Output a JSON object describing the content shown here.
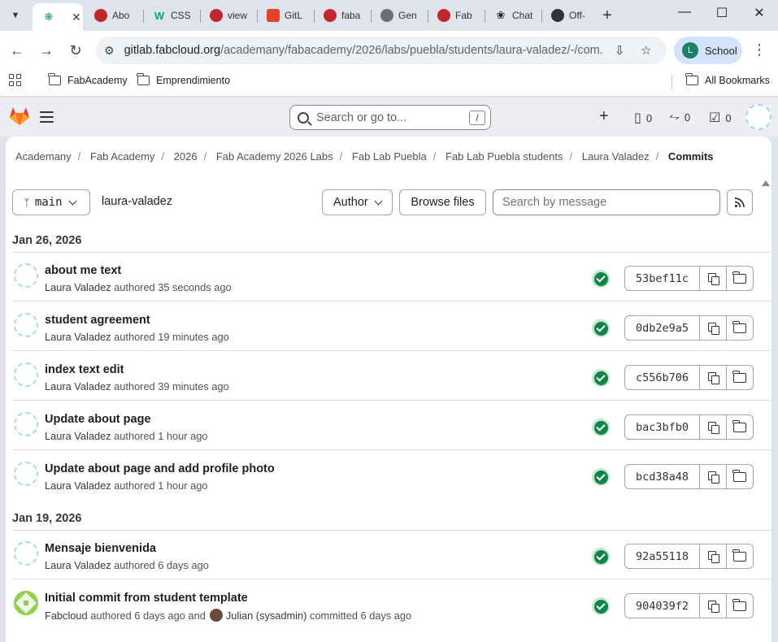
{
  "browser": {
    "tabs": [
      {
        "label": "",
        "favicon": "gitlab-swirl-icon",
        "active": true
      },
      {
        "label": "Abo",
        "favicon": "fab-lab-icon"
      },
      {
        "label": "CSS",
        "favicon": "w3schools-icon"
      },
      {
        "label": "view",
        "favicon": "fab-lab-icon"
      },
      {
        "label": "GitL",
        "favicon": "gitlab-icon"
      },
      {
        "label": "faba",
        "favicon": "fab-lab-icon"
      },
      {
        "label": "Gen",
        "favicon": "globe-icon"
      },
      {
        "label": "Fab",
        "favicon": "fab-lab-icon"
      },
      {
        "label": "Chat",
        "favicon": "chatgpt-icon"
      },
      {
        "label": "Off-",
        "favicon": "offline-icon"
      }
    ],
    "url_host": "gitlab.fabcloud.org",
    "url_path": "/academany/fabacademy/2026/labs/puebla/students/laura-valadez/-/com...",
    "profile_initial": "L",
    "profile_name": "School",
    "bookmarks": [
      "FabAcademy",
      "Emprendimiento"
    ],
    "all_bookmarks": "All Bookmarks"
  },
  "gitlab": {
    "search_placeholder": "Search or go to...",
    "search_shortcut": "/",
    "counts": {
      "issues": "0",
      "merge_requests": "0",
      "todos": "0"
    },
    "breadcrumbs": [
      "Academany",
      "Fab Academy",
      "2026",
      "Fab Academy 2026 Labs",
      "Fab Lab Puebla",
      "Fab Lab Puebla students",
      "Laura Valadez"
    ],
    "breadcrumb_current": "Commits",
    "branch": "main",
    "path": "laura-valadez",
    "author_label": "Author",
    "browse_label": "Browse files",
    "message_placeholder": "Search by message",
    "days": [
      {
        "date": "Jan 26, 2026",
        "commits": [
          {
            "title": "about me text",
            "author": "Laura Valadez",
            "action": "authored 35 seconds ago",
            "sha": "53bef11c"
          },
          {
            "title": "student agreement",
            "author": "Laura Valadez",
            "action": "authored 19 minutes ago",
            "sha": "0db2e9a5"
          },
          {
            "title": "index text edit",
            "author": "Laura Valadez",
            "action": "authored 39 minutes ago",
            "sha": "c556b706"
          },
          {
            "title": "Update about page",
            "author": "Laura Valadez",
            "action": "authored 1 hour ago",
            "sha": "bac3bfb0"
          },
          {
            "title": "Update about page and add profile photo",
            "author": "Laura Valadez",
            "action": "authored 1 hour ago",
            "sha": "bcd38a48"
          }
        ]
      },
      {
        "date": "Jan 19, 2026",
        "commits": [
          {
            "title": "Mensaje bienvenida",
            "author": "Laura Valadez",
            "action": "authored 6 days ago",
            "sha": "92a55118"
          },
          {
            "title": "Initial commit from student template",
            "author": "Fabcloud",
            "action": "authored 6 days ago and",
            "committer": "Julian (sysadmin)",
            "committer_action": "committed 6 days ago",
            "sha": "904039f2"
          }
        ]
      }
    ]
  },
  "colors": {
    "status_success": "#108548",
    "gitlab_orange": "#e24329"
  }
}
